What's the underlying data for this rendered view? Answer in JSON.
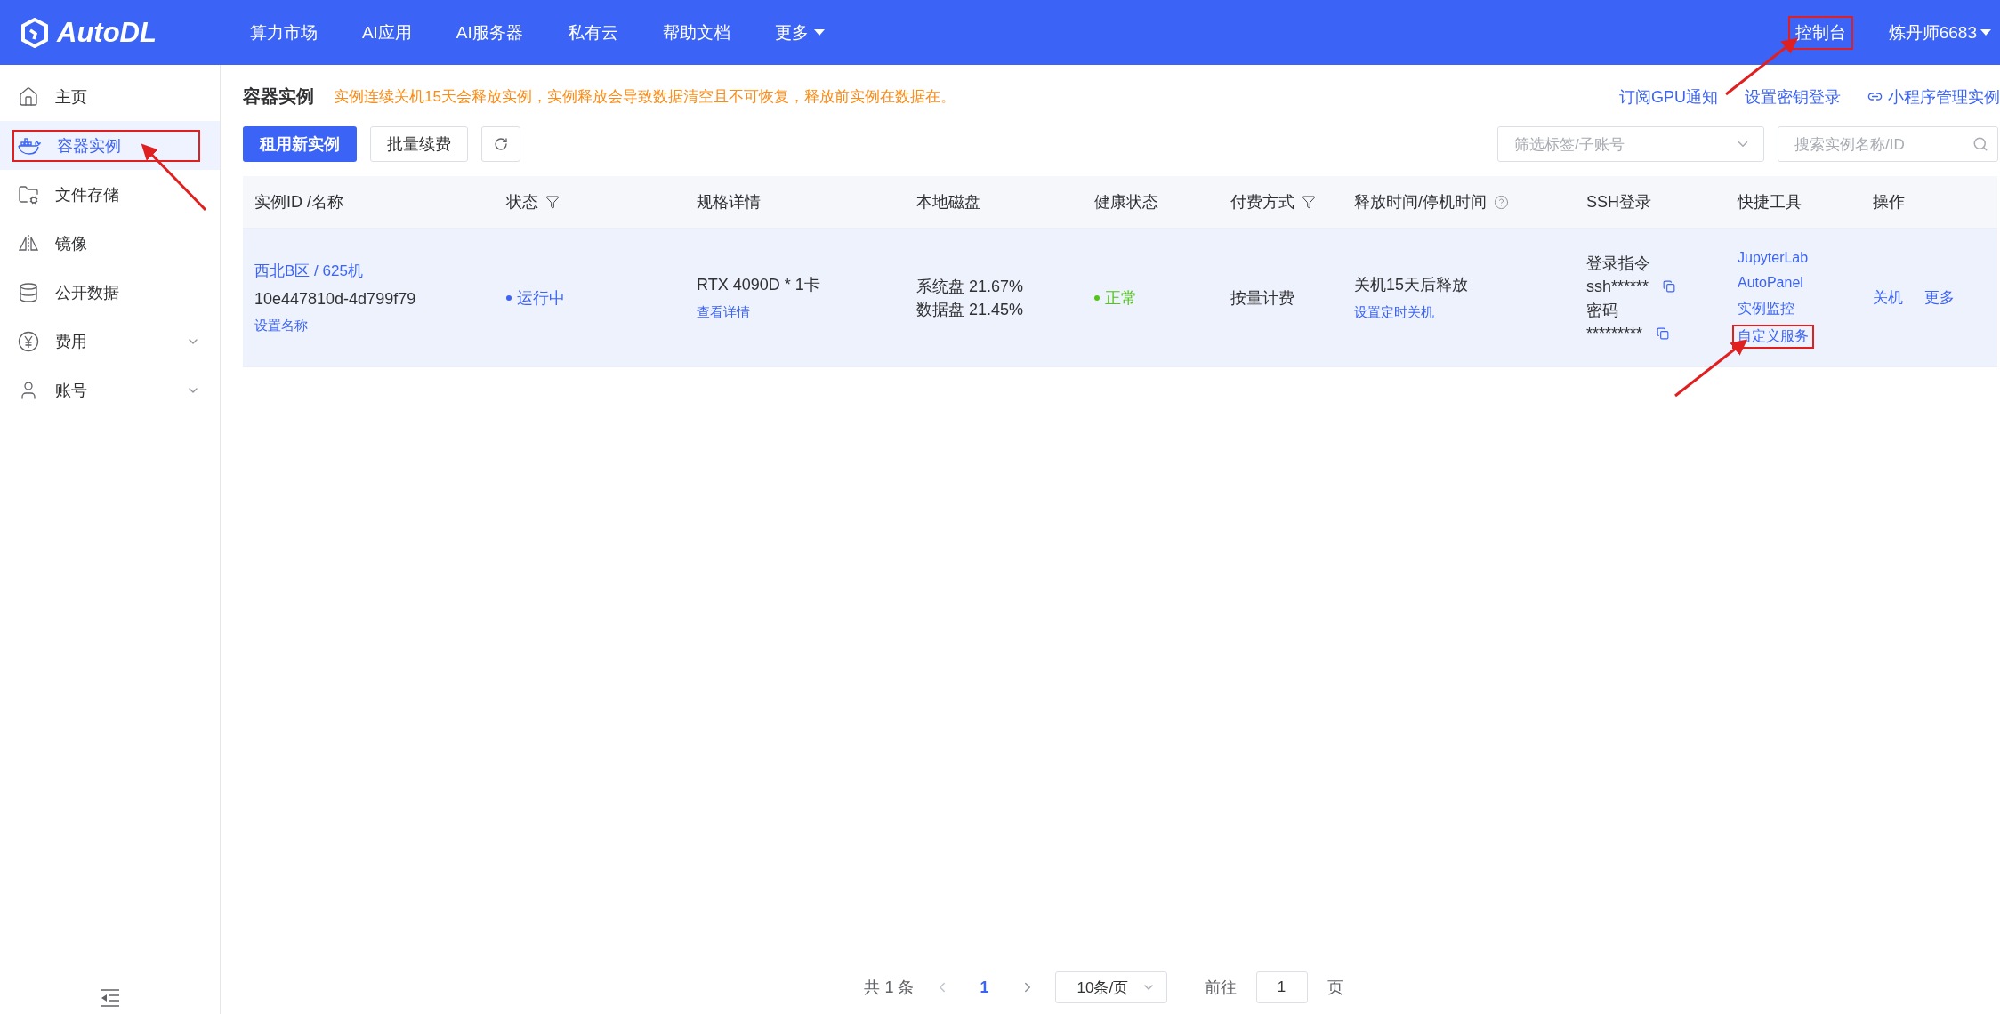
{
  "header": {
    "logo": "AutoDL",
    "nav": [
      {
        "label": "算力市场",
        "dropdown": false
      },
      {
        "label": "AI应用",
        "dropdown": false
      },
      {
        "label": "AI服务器",
        "dropdown": false
      },
      {
        "label": "私有云",
        "dropdown": false
      },
      {
        "label": "帮助文档",
        "dropdown": false
      },
      {
        "label": "更多",
        "dropdown": true
      }
    ],
    "console": {
      "label": "控制台",
      "highlighted": true
    },
    "user": {
      "label": "炼丹师6683"
    }
  },
  "sidebar": {
    "items": [
      {
        "label": "主页",
        "kind": "home",
        "selected": false,
        "expandable": false,
        "highlighted": false
      },
      {
        "label": "容器实例",
        "kind": "container",
        "selected": true,
        "expandable": false,
        "highlighted": true
      },
      {
        "label": "文件存储",
        "kind": "folder",
        "selected": false,
        "expandable": false,
        "highlighted": false
      },
      {
        "label": "镜像",
        "kind": "mirror",
        "selected": false,
        "expandable": false,
        "highlighted": false
      },
      {
        "label": "公开数据",
        "kind": "database",
        "selected": false,
        "expandable": false,
        "highlighted": false
      },
      {
        "label": "费用",
        "kind": "yen",
        "selected": false,
        "expandable": true,
        "highlighted": false
      },
      {
        "label": "账号",
        "kind": "user",
        "selected": false,
        "expandable": true,
        "highlighted": false
      }
    ]
  },
  "page": {
    "title": "容器实例",
    "notice": "实例连续关机15天会释放实例，实例释放会导致数据清空且不可恢复，释放前实例在数据在。",
    "links": [
      {
        "label": "订阅GPU通知",
        "icon": false
      },
      {
        "label": "设置密钥登录",
        "icon": false
      },
      {
        "label": "小程序管理实例",
        "icon": true
      }
    ],
    "primary_button": "租用新实例",
    "secondary_button": "批量续费",
    "filter": {
      "placeholder": "筛选标签/子账号"
    },
    "search": {
      "placeholder": "搜索实例名称/ID"
    }
  },
  "table": {
    "columns": [
      {
        "label": "实例ID /名称",
        "filter": false,
        "help": false
      },
      {
        "label": "状态",
        "filter": true,
        "help": false
      },
      {
        "label": "规格详情",
        "filter": false,
        "help": false
      },
      {
        "label": "本地磁盘",
        "filter": false,
        "help": false
      },
      {
        "label": "健康状态",
        "filter": false,
        "help": false
      },
      {
        "label": "付费方式",
        "filter": true,
        "help": false
      },
      {
        "label": "释放时间/停机时间",
        "filter": false,
        "help": true
      },
      {
        "label": "SSH登录",
        "filter": false,
        "help": false
      },
      {
        "label": "快捷工具",
        "filter": false,
        "help": false
      },
      {
        "label": "操作",
        "filter": false,
        "help": false
      }
    ],
    "rows": [
      {
        "name": "西北B区 / 625机",
        "id": "10e447810d-4d799f79",
        "rename": "设置名称",
        "status": "运行中",
        "spec": "RTX 4090D * 1卡",
        "spec_link": "查看详情",
        "disk": [
          "系统盘 21.67%",
          "数据盘 21.45%"
        ],
        "health": "正常",
        "billing": "按量计费",
        "release": "关机15天后释放",
        "release_link": "设置定时关机",
        "ssh": {
          "command_label": "登录指令",
          "command": "ssh******",
          "password_label": "密码",
          "password": "*********"
        },
        "tools": [
          {
            "label": "JupyterLab",
            "highlighted": false
          },
          {
            "label": "AutoPanel",
            "highlighted": false
          },
          {
            "label": "实例监控",
            "highlighted": false
          },
          {
            "label": "自定义服务",
            "highlighted": true
          }
        ],
        "actions": [
          "关机",
          "更多"
        ]
      }
    ]
  },
  "pagination": {
    "total": "共 1 条",
    "pages": [
      {
        "label": "1",
        "selected": true
      }
    ],
    "page_size": "10条/页",
    "goto": "前往",
    "goto_value": "1",
    "unit": "页"
  }
}
